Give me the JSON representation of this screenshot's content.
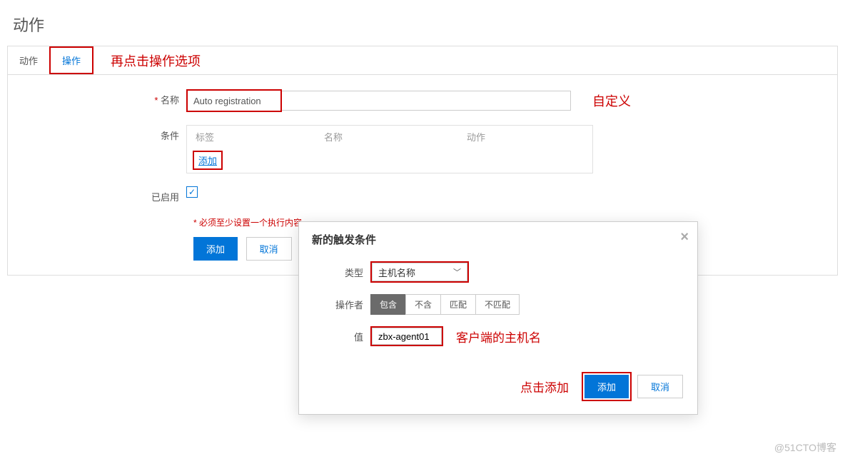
{
  "page": {
    "title": "动作"
  },
  "tabs": {
    "tab1": "动作",
    "tab2": "操作",
    "annotation": "再点击操作选项"
  },
  "form": {
    "name_label": "名称",
    "name_value": "Auto registration",
    "name_annotation": "自定义",
    "cond_label": "条件",
    "cond_col1": "标签",
    "cond_col2": "名称",
    "cond_col3": "动作",
    "cond_add": "添加",
    "enabled_label": "已启用",
    "hint": "必须至少设置一个执行内容。",
    "add_btn": "添加",
    "cancel_btn": "取消"
  },
  "modal": {
    "title": "新的触发条件",
    "type_label": "类型",
    "type_value": "主机名称",
    "operator_label": "操作者",
    "op1": "包含",
    "op2": "不含",
    "op3": "匹配",
    "op4": "不匹配",
    "value_label": "值",
    "value_value": "zbx-agent01",
    "value_annotation": "客户端的主机名",
    "footer_annotation": "点击添加",
    "add_btn": "添加",
    "cancel_btn": "取消"
  },
  "watermark": "@51CTO博客"
}
